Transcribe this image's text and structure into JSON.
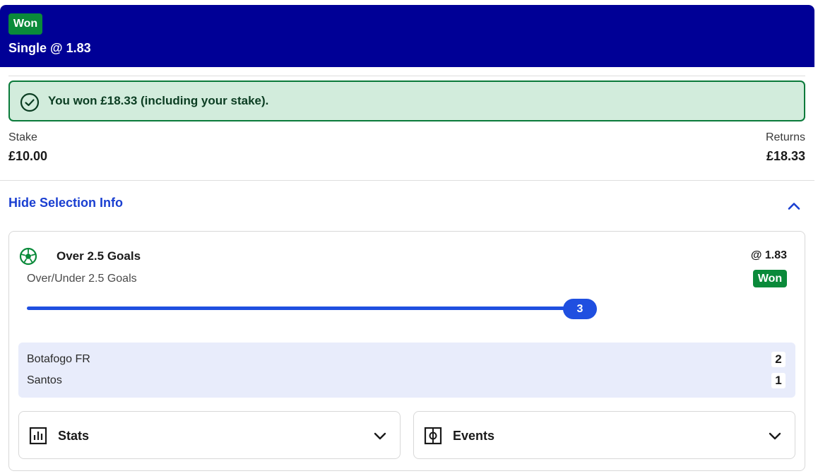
{
  "header": {
    "status_badge": "Won",
    "title": "Single @ 1.83",
    "background_color": "#000096"
  },
  "win_banner": {
    "message": "You won £18.33 (including your stake).",
    "icon": "check-circle-icon",
    "color": "#0a7a3a"
  },
  "summary": {
    "stake_label": "Stake",
    "stake_value": "£10.00",
    "returns_label": "Returns",
    "returns_value": "£18.33"
  },
  "selection_toggle": {
    "label": "Hide Selection Info",
    "icon": "chevron-up-icon"
  },
  "selection": {
    "icon": "football-icon",
    "name": "Over 2.5 Goals",
    "market": "Over/Under 2.5 Goals",
    "odds": "@ 1.83",
    "status_badge": "Won",
    "goals_progress_value": "3"
  },
  "match": {
    "teams": [
      {
        "name": "Botafogo FR",
        "score": "2"
      },
      {
        "name": "Santos",
        "score": "1"
      }
    ]
  },
  "panels": {
    "stats": {
      "label": "Stats",
      "icon": "bar-chart-icon"
    },
    "events": {
      "label": "Events",
      "icon": "pitch-icon"
    }
  },
  "colors": {
    "accent_blue": "#1f4fe0",
    "win_green": "#0a8a3a",
    "link_blue": "#1a3fd1"
  }
}
